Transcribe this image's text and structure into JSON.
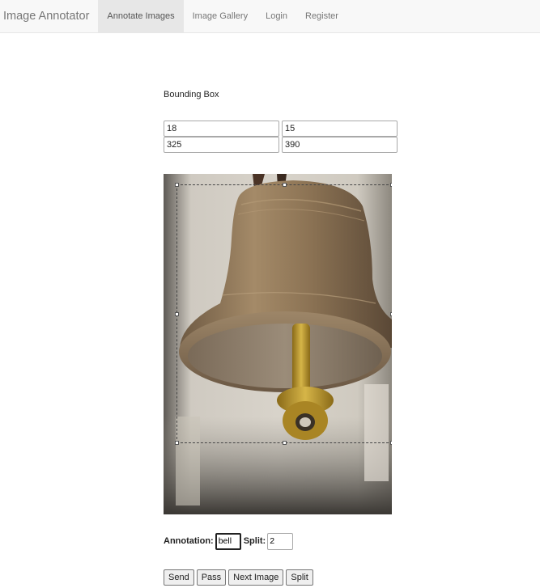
{
  "navbar": {
    "brand": "Image Annotator",
    "links": [
      {
        "label": "Annotate Images",
        "active": true
      },
      {
        "label": "Image Gallery",
        "active": false
      },
      {
        "label": "Login",
        "active": false
      },
      {
        "label": "Register",
        "active": false
      }
    ]
  },
  "bounding_box": {
    "label": "Bounding Box",
    "x1": "18",
    "y1": "15",
    "x2": "325",
    "y2": "390"
  },
  "image": {
    "subject": "bell"
  },
  "annotation": {
    "label": "Annotation:",
    "value": "bell",
    "split_label": "Split:",
    "split_value": "2"
  },
  "buttons": {
    "send": "Send",
    "pass": "Pass",
    "next": "Next Image",
    "split": "Split"
  }
}
